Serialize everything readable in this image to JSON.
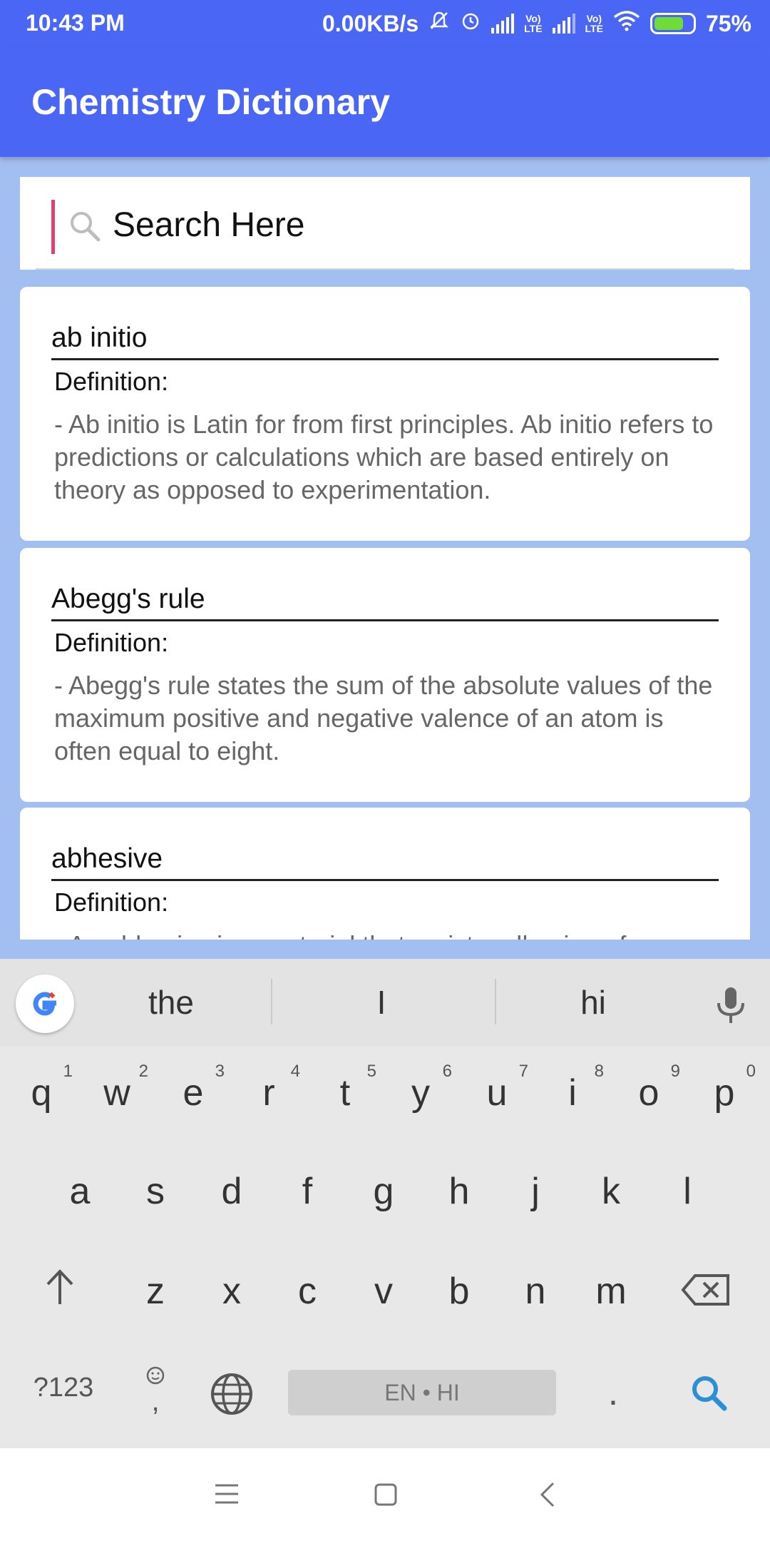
{
  "status_bar": {
    "time": "10:43 PM",
    "network_speed": "0.00KB/s",
    "battery_percent": "75%",
    "icons": [
      "muted-bell-icon",
      "alarm-icon",
      "signal-icon",
      "volte-icon",
      "signal-icon",
      "volte-icon",
      "wifi-icon",
      "battery-charging-icon"
    ],
    "volte_label": "Vo)\nLTE"
  },
  "app_bar": {
    "title": "Chemistry Dictionary"
  },
  "search": {
    "placeholder": "Search Here"
  },
  "entries": [
    {
      "term": "ab initio",
      "definition_label": "Definition:",
      "definition": "- Ab initio is Latin for from first principles. Ab initio refers to predictions or calculations which are based entirely on theory as opposed to experimentation."
    },
    {
      "term": "Abegg's rule",
      "definition_label": "Definition:",
      "definition": "- Abegg's rule states the sum of the absolute values of the maximum positive and negative valence of an atom is often equal to eight."
    },
    {
      "term": "abhesive",
      "definition_label": "Definition:",
      "definition": "- An abhesive is a material that resists adhesion of"
    }
  ],
  "keyboard": {
    "suggestions": [
      "the",
      "I",
      "hi"
    ],
    "row1": [
      {
        "k": "q",
        "n": "1"
      },
      {
        "k": "w",
        "n": "2"
      },
      {
        "k": "e",
        "n": "3"
      },
      {
        "k": "r",
        "n": "4"
      },
      {
        "k": "t",
        "n": "5"
      },
      {
        "k": "y",
        "n": "6"
      },
      {
        "k": "u",
        "n": "7"
      },
      {
        "k": "i",
        "n": "8"
      },
      {
        "k": "o",
        "n": "9"
      },
      {
        "k": "p",
        "n": "0"
      }
    ],
    "row2": [
      "a",
      "s",
      "d",
      "f",
      "g",
      "h",
      "j",
      "k",
      "l"
    ],
    "row3": [
      "z",
      "x",
      "c",
      "v",
      "b",
      "n",
      "m"
    ],
    "symbols_label": "?123",
    "comma_label": ",",
    "space_label": "EN • HI",
    "period_label": ".",
    "accent_color": "#2b8fd6"
  },
  "colors": {
    "primary": "#4a66f5",
    "background": "#a3bef0",
    "cursor": "#e2406f"
  }
}
